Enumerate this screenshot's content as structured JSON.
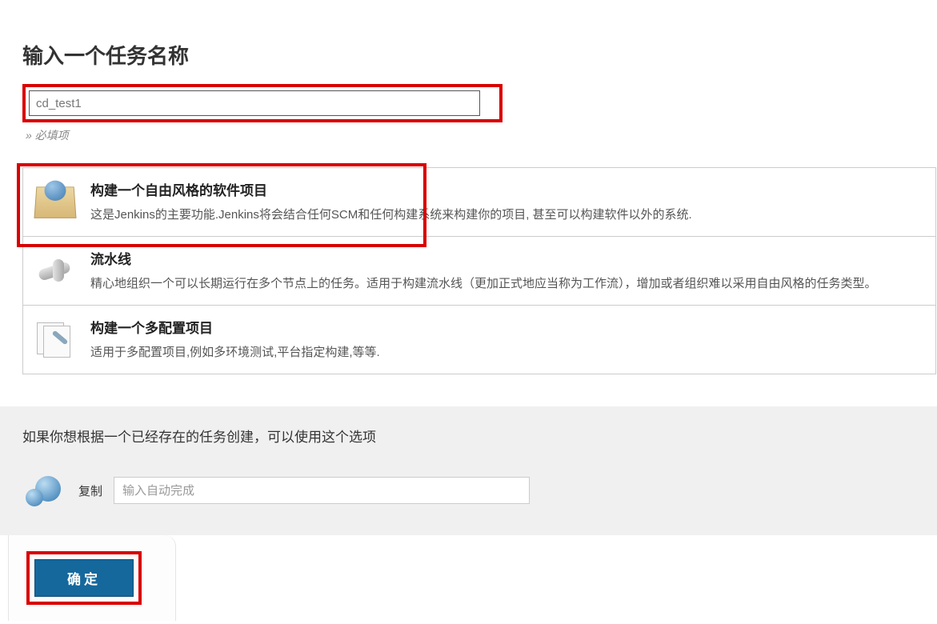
{
  "header": {
    "title": "输入一个任务名称",
    "name_value": "cd_test1",
    "required_hint": "» 必填项"
  },
  "items": [
    {
      "key": "freestyle",
      "title": "构建一个自由风格的软件项目",
      "desc": "这是Jenkins的主要功能.Jenkins将会结合任何SCM和任何构建系统来构建你的项目, 甚至可以构建软件以外的系统."
    },
    {
      "key": "pipeline",
      "title": "流水线",
      "desc": "精心地组织一个可以长期运行在多个节点上的任务。适用于构建流水线（更加正式地应当称为工作流），增加或者组织难以采用自由风格的任务类型。"
    },
    {
      "key": "multiconfig",
      "title": "构建一个多配置项目",
      "desc": "适用于多配置项目,例如多环境测试,平台指定构建,等等."
    }
  ],
  "copy": {
    "hint": "如果你想根据一个已经存在的任务创建，可以使用这个选项",
    "label": "复制",
    "placeholder": "输入自动完成"
  },
  "footer": {
    "ok_label": "确定"
  }
}
